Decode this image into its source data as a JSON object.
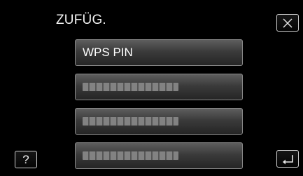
{
  "screen": {
    "title": "ZUFÜG.",
    "items": [
      {
        "label": "WPS PIN"
      },
      {
        "label": ""
      },
      {
        "label": ""
      },
      {
        "label": ""
      }
    ],
    "help_label": "?"
  }
}
